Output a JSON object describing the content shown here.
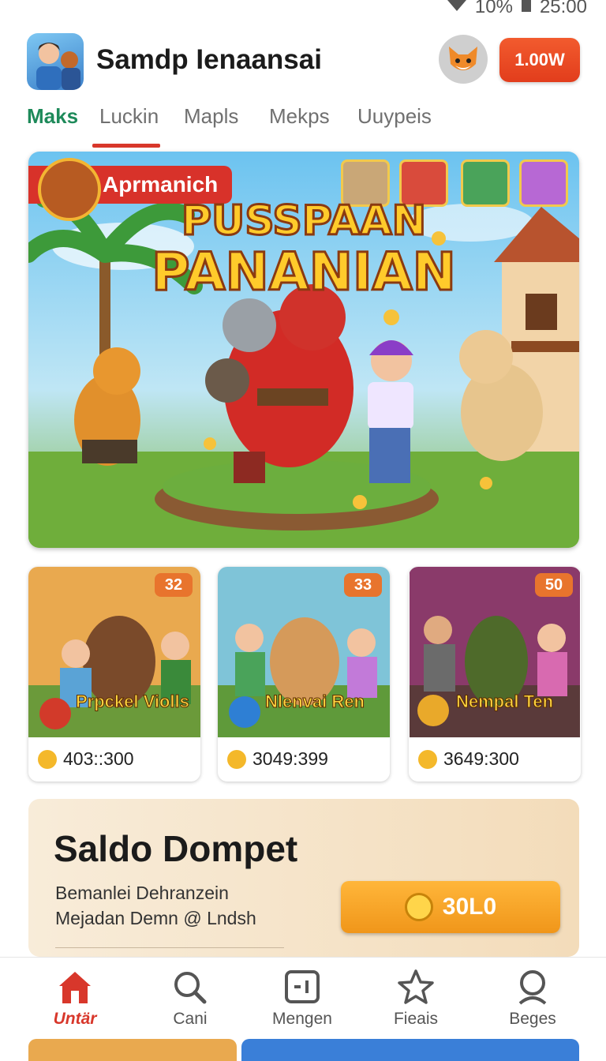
{
  "status_bar": {
    "battery": "10%",
    "time": "25:00"
  },
  "header": {
    "title": "Samdp Ienaansai",
    "coin_balance": "1.00W"
  },
  "tabs": [
    {
      "label": "Maks",
      "active": true
    },
    {
      "label": "Luckin",
      "active": false
    },
    {
      "label": "Mapls",
      "active": false
    },
    {
      "label": "Mekps",
      "active": false
    },
    {
      "label": "Uuypeis",
      "active": false
    }
  ],
  "hero": {
    "badge": "Aprmanich",
    "title_line1": "PUSSPAAN",
    "title_line2": "PANANIAN"
  },
  "cards": [
    {
      "rank": "32",
      "title": "Prpckel Violls",
      "stat": "403::300"
    },
    {
      "rank": "33",
      "title": "Nlenvai Ren",
      "stat": "3049:399"
    },
    {
      "rank": "50",
      "title": "Nempal Ten",
      "stat": "3649:300"
    }
  ],
  "wallet": {
    "title": "Saldo Dompet",
    "line1": "Bemanlei Dehranzein",
    "line2": "Mejadan Demn @ Lndsh",
    "button_value": "30L0"
  },
  "bottom_nav": [
    {
      "label": "Untär",
      "icon": "home-icon",
      "active": true
    },
    {
      "label": "Cani",
      "icon": "search-icon",
      "active": false
    },
    {
      "label": "Mengen",
      "icon": "game-icon",
      "active": false
    },
    {
      "label": "Fieais",
      "icon": "star-icon",
      "active": false
    },
    {
      "label": "Beges",
      "icon": "profile-search-icon",
      "active": false
    }
  ],
  "colors": {
    "accent_red": "#d8372b",
    "active_tab": "#1e8a5a",
    "coin_orange": "#f0961a"
  }
}
